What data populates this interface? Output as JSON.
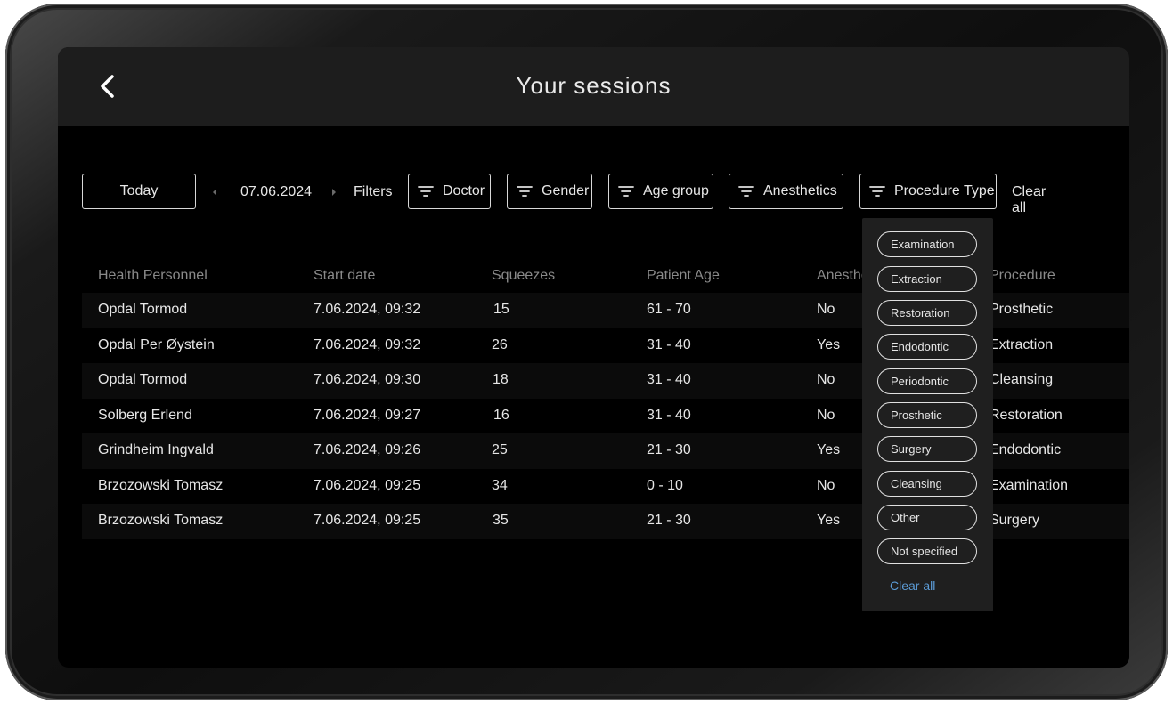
{
  "header": {
    "title": "Your sessions"
  },
  "toolbar": {
    "today_label": "Today",
    "date": "07.06.2024",
    "filters_label": "Filters",
    "filter_buttons": [
      "Doctor",
      "Gender",
      "Age group",
      "Anesthetics",
      "Procedure Type"
    ],
    "clear_all_label": "Clear all"
  },
  "table": {
    "columns": [
      "Health Personnel",
      "Start date",
      "Squeezes",
      "Patient Age",
      "Anesthe",
      "Procedure"
    ],
    "rows": [
      [
        "Opdal Tormod",
        "7.06.2024, 09:32",
        "15",
        "61 - 70",
        "No",
        "Prosthetic"
      ],
      [
        "Opdal Per Øystein",
        "7.06.2024, 09:32",
        "26",
        "31 - 40",
        "Yes",
        "Extraction"
      ],
      [
        "Opdal Tormod",
        "7.06.2024, 09:30",
        "18",
        "31 - 40",
        "No",
        "Cleansing"
      ],
      [
        "Solberg Erlend",
        "7.06.2024, 09:27",
        "16",
        "31 - 40",
        "No",
        "Restoration"
      ],
      [
        "Grindheim Ingvald",
        "7.06.2024, 09:26",
        "25",
        "21 - 30",
        "Yes",
        "Endodontic"
      ],
      [
        "Brzozowski Tomasz",
        "7.06.2024, 09:25",
        "34",
        "0 - 10",
        "No",
        "Examination"
      ],
      [
        "Brzozowski Tomasz",
        "7.06.2024, 09:25",
        "35",
        "21 - 30",
        "Yes",
        "Surgery"
      ]
    ]
  },
  "procedure_dropdown": {
    "options": [
      "Examination",
      "Extraction",
      "Restoration",
      "Endodontic",
      "Periodontic",
      "Prosthetic",
      "Surgery",
      "Cleansing",
      "Other",
      "Not specified"
    ],
    "clear_all_label": "Clear all"
  },
  "colors": {
    "background": "#000000",
    "header": "#1d1d1d",
    "dropdown": "#1f1f1f",
    "link": "#5b9bd6",
    "muted_text": "#8a8a8a"
  },
  "icons": {
    "back": "chevron-left-icon",
    "filter": "filter-lines-icon",
    "prev_date": "caret-left-icon",
    "next_date": "caret-right-icon"
  }
}
